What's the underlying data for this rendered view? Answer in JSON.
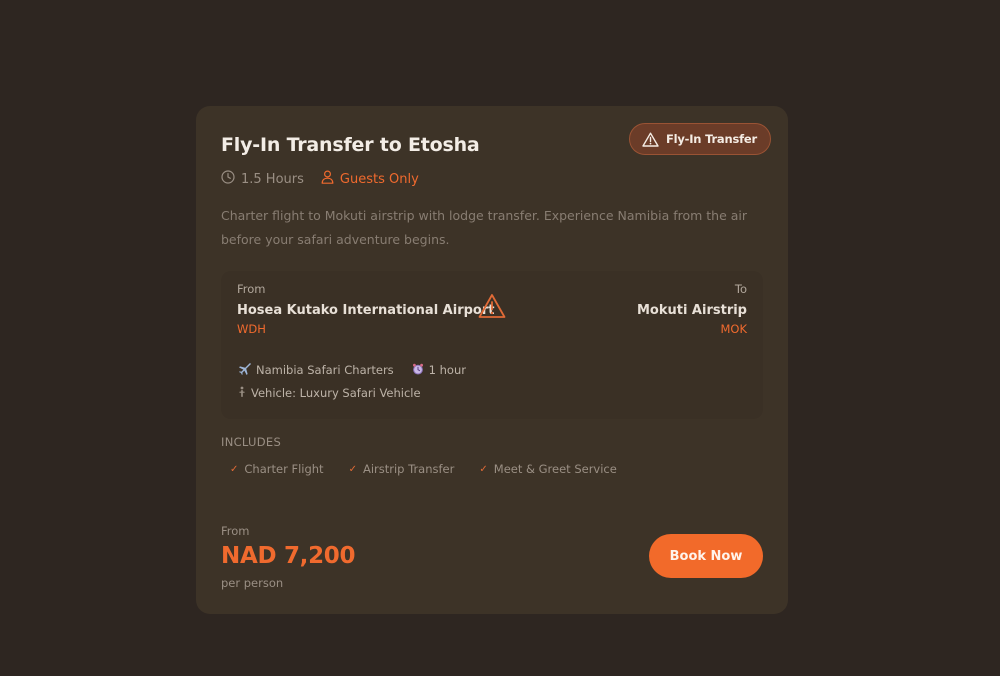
{
  "card": {
    "title": "Fly-In Transfer to Etosha",
    "badge": {
      "label": "Fly-In Transfer",
      "icon": "warning-icon"
    },
    "meta": {
      "duration": "1.5 Hours",
      "duration_icon": "clock-icon",
      "audience": "Guests Only",
      "audience_icon": "person-icon"
    },
    "description": "Charter flight to Mokuti airstrip with lodge transfer. Experience Namibia from the air before your safari adventure begins.",
    "route": {
      "from_label": "From",
      "from_name": "Hosea Kutako International Airport",
      "from_code": "WDH",
      "to_label": "To",
      "to_name": "Mokuti Airstrip",
      "to_code": "MOK",
      "route_icon": "warning-icon",
      "operator": "Namibia Safari Charters",
      "operator_icon": "airplane-icon",
      "flight_time": "1 hour",
      "flight_time_icon": "alarm-clock-icon",
      "vehicle": "Vehicle: Luxury Safari Vehicle",
      "vehicle_icon": "vehicle-icon"
    },
    "includes": {
      "heading": "INCLUDES",
      "items": [
        "Charter Flight",
        "Airstrip Transfer",
        "Meet & Greet Service"
      ]
    },
    "pricing": {
      "from_label": "From",
      "price": "NAD 7,200",
      "unit": "per person"
    },
    "cta": {
      "label": "Book Now"
    }
  },
  "colors": {
    "page_background": "#2e2621",
    "card_background": "#3d3327",
    "accent": "#f26a2a",
    "badge_background": "#6b3c28"
  }
}
